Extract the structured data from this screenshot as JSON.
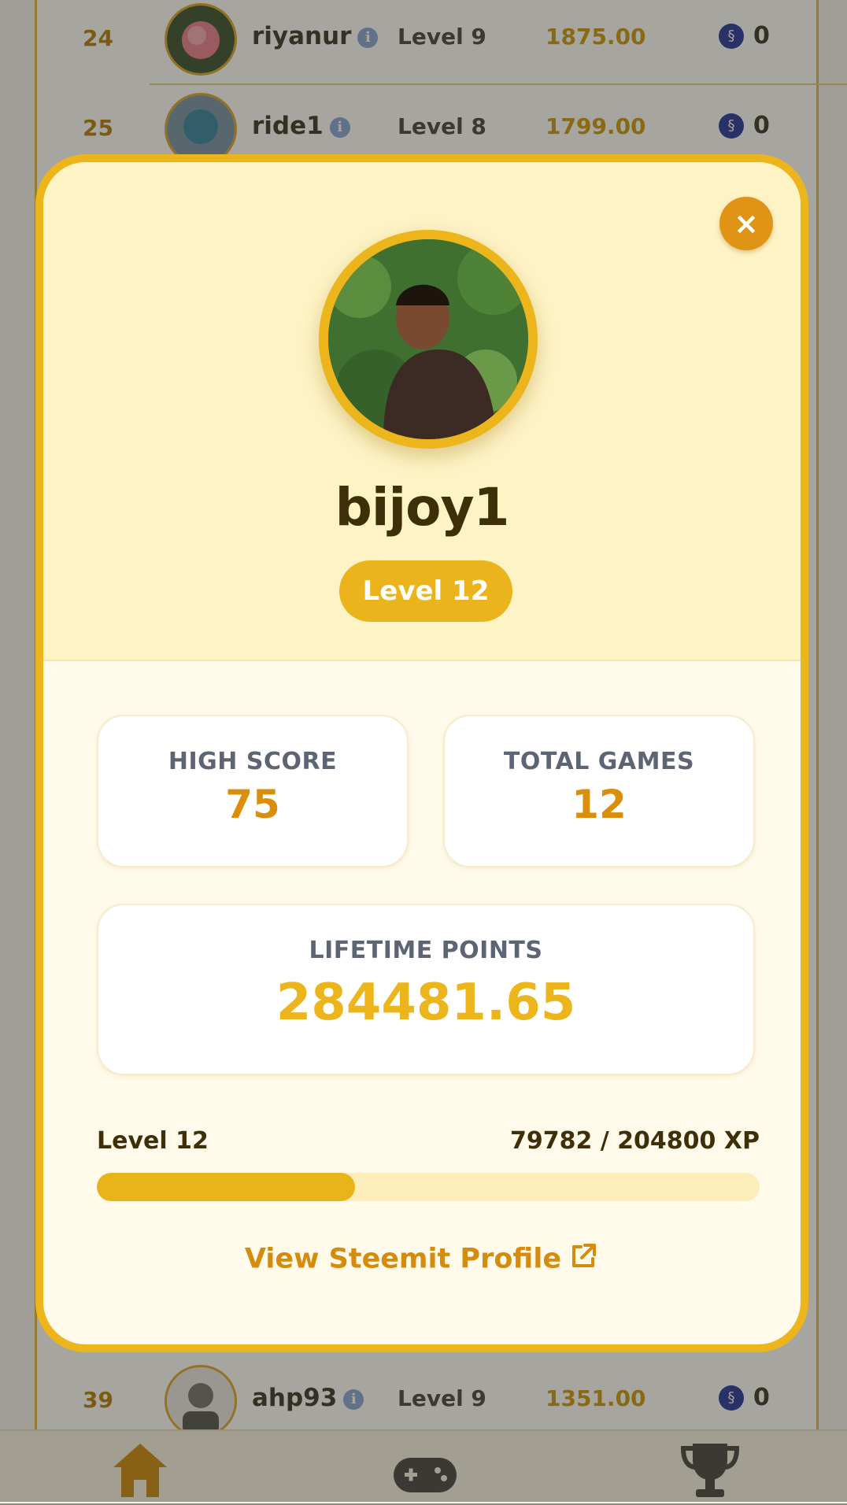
{
  "leaderboard": {
    "rows": [
      {
        "rank": "24",
        "username": "riyanur",
        "level": "Level 9",
        "points": "1875.00",
        "reward": "0"
      },
      {
        "rank": "25",
        "username": "ride1",
        "level": "Level 8",
        "points": "1799.00",
        "reward": "0"
      },
      {
        "rank": "39",
        "username": "ahp93",
        "level": "Level 9",
        "points": "1351.00",
        "reward": "0"
      }
    ],
    "info_icon_glyph": "i"
  },
  "profile_modal": {
    "close_glyph": "×",
    "username": "bijoy1",
    "level_badge": "Level 12",
    "stats": {
      "high_score_label": "HIGH SCORE",
      "high_score_value": "75",
      "total_games_label": "TOTAL GAMES",
      "total_games_value": "12",
      "lifetime_points_label": "LIFETIME POINTS",
      "lifetime_points_value": "284481.65"
    },
    "xp": {
      "level_label": "Level 12",
      "progress_text": "79782 / 204800 XP",
      "current": 79782,
      "required": 204800
    },
    "steemit_link": "View Steemit Profile"
  },
  "bottom_nav": {
    "items": [
      "home-icon",
      "gamepad-icon",
      "trophy-icon"
    ]
  },
  "colors": {
    "accent": "#ecb51c",
    "accent_dark": "#db8e0b",
    "header_bg": "#fef3c5",
    "modal_bg": "#fffaea",
    "text_dark": "#3e2f08"
  }
}
